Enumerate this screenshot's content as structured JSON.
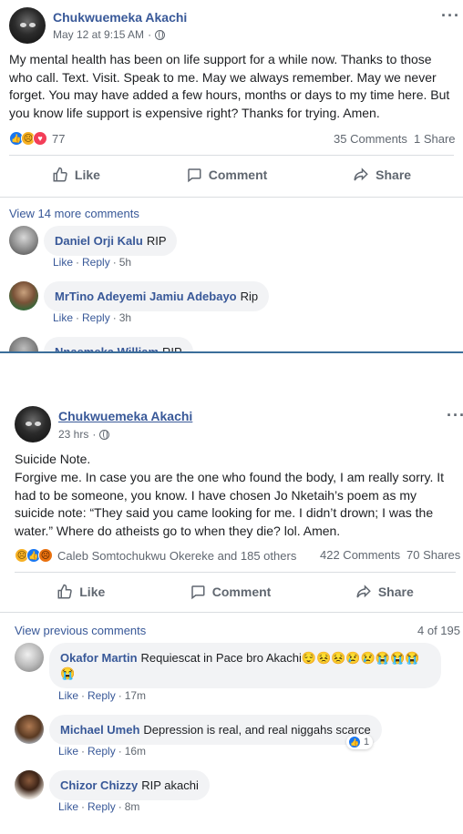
{
  "post1": {
    "author": "Chukwuemeka Akachi",
    "timestamp": "May 12 at 9:15 AM",
    "privacy_icon": "globe-icon",
    "text": "My mental health has been on life support for a while now. Thanks to those who call. Text. Visit. Speak to me. May we always remember. May we never forget. You may have added a few hours, months or days to my time here. But you know life support is expensive right? Thanks for trying. Amen.",
    "reactions": [
      "like",
      "sad",
      "love"
    ],
    "reaction_count": "77",
    "comments_count": "35 Comments",
    "shares_count": "1 Share",
    "actions": {
      "like": "Like",
      "comment": "Comment",
      "share": "Share"
    },
    "view_more": "View 14 more comments",
    "comments": [
      {
        "name": "Daniel Orji Kalu",
        "text": "RIP",
        "like": "Like",
        "reply": "Reply",
        "time": "5h"
      },
      {
        "name": "MrTino Adeyemi Jamiu Adebayo",
        "text": "Rip",
        "like": "Like",
        "reply": "Reply",
        "time": "3h"
      },
      {
        "name": "Nnaemeka William",
        "text": "RIP"
      }
    ]
  },
  "post2": {
    "author": "Chukwuemeka Akachi",
    "timestamp": "23 hrs",
    "privacy_icon": "globe-icon",
    "text_title": "Suicide Note.",
    "text": "Forgive me. In case you are the one who found the body, I am really sorry. It had to be someone, you know. I have chosen Jo Nketaih’s poem as my suicide note: “They said you came looking for me. I didn’t drown; I was the water.” Where do atheists go to when they die? lol. Amen.",
    "reactions": [
      "sad",
      "like",
      "angry"
    ],
    "reactors": "Caleb Somtochukwu Okereke and 185 others",
    "comments_count": "422 Comments",
    "shares_count": "70 Shares",
    "actions": {
      "like": "Like",
      "comment": "Comment",
      "share": "Share"
    },
    "view_previous": "View previous comments",
    "page_count": "4 of 195",
    "comments": [
      {
        "name": "Okafor Martin",
        "text": "Requiescat in Pace bro Akachi😌😣😣😢😢😭😭😭",
        "text2": "😭",
        "like": "Like",
        "reply": "Reply",
        "time": "17m"
      },
      {
        "name": "Michael Umeh",
        "text": "Depression is real, and real niggahs scarce",
        "like": "Like",
        "reply": "Reply",
        "time": "16m",
        "likes": "1"
      },
      {
        "name": "Chizor Chizzy",
        "text": "RIP akachi",
        "like": "Like",
        "reply": "Reply",
        "time": "8m"
      }
    ]
  },
  "colors": {
    "link": "#385898",
    "meta": "#606770",
    "bubble": "#f2f3f5",
    "like_blue": "#1877f2"
  }
}
